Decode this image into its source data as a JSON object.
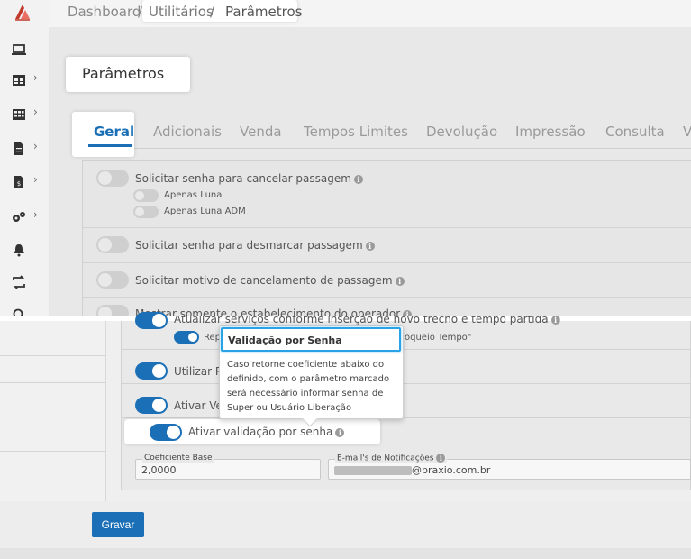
{
  "breadcrumb": {
    "dashboard": "Dashboard",
    "sep1": "/",
    "utilitarios": "Utilitários",
    "sep2": "/",
    "parametros": "Parâmetros"
  },
  "page": {
    "title": "Parâmetros"
  },
  "tabs": [
    {
      "label": "Geral"
    },
    {
      "label": "Adicionais"
    },
    {
      "label": "Venda"
    },
    {
      "label": "Tempos Limites"
    },
    {
      "label": "Devolução"
    },
    {
      "label": "Impressão"
    },
    {
      "label": "Consulta"
    },
    {
      "label": "V"
    }
  ],
  "settings_top": [
    {
      "label": "Solicitar senha para cancelar passagem"
    },
    {
      "label": "Apenas Luna"
    },
    {
      "label": "Apenas Luna ADM"
    },
    {
      "label": "Solicitar senha para desmarcar passagem"
    },
    {
      "label": "Solicitar motivo de cancelamento de passagem"
    },
    {
      "label": "Mostrar somente o estabelecimento do operador"
    }
  ],
  "settings_bottom": {
    "row1": "Atualizar serviços conforme inserção de novo trecho e tempo partida",
    "row1_sub": "Rep",
    "row1_sub_tail": "oqueio Tempo\"",
    "row2": "Utilizar Pa",
    "row3": "Ativar Veri",
    "row4": "Ativar validação por senha"
  },
  "tooltip": {
    "title": "Validação por Senha",
    "body": "Caso retorne coeficiente abaixo do definido, com o parâmetro marcado será necessário informar senha de Super ou Usuário Liberação"
  },
  "fields": {
    "coef_label": "Coeficiente Base",
    "coef_value": "2,0000",
    "email_label": "E-mail's de Notificações",
    "email_value": "@praxio.com.br"
  },
  "buttons": {
    "save": "Gravar"
  },
  "icons": [
    "logo-icon",
    "laptop-icon",
    "table-icon",
    "grid-icon",
    "document-icon",
    "invoice-icon",
    "gears-icon",
    "bell-icon",
    "sync-icon",
    "search-icon",
    "info-icon"
  ],
  "colors": {
    "accent": "#1b6fb6",
    "highlight": "#29a3e6"
  }
}
